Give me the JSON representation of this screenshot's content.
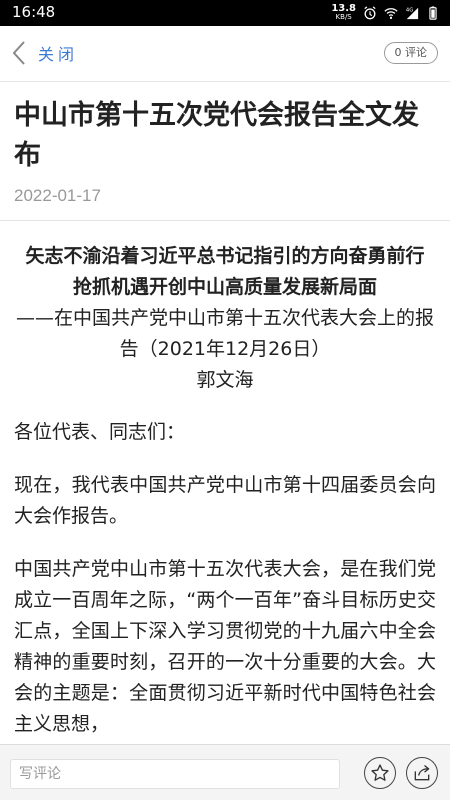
{
  "status_bar": {
    "time": "16:48",
    "net_speed_value": "13.8",
    "net_speed_unit": "KB/S",
    "network_type": "4G",
    "icons": [
      "alarm-icon",
      "wifi-icon",
      "signal-icon",
      "battery-icon"
    ]
  },
  "nav": {
    "back_label": "关闭",
    "comment_count": "0 评论"
  },
  "article": {
    "title": "中山市第十五次党代会报告全文发布",
    "date": "2022-01-17",
    "speech_title": "矢志不渝沿着习近平总书记指引的方向奋勇前行 抢抓机遇开创中山高质量发展新局面",
    "speech_subtitle": "——在中国共产党中山市第十五次代表大会上的报告（2021年12月26日）",
    "speech_author": "郭文海",
    "paragraphs": [
      "各位代表、同志们：",
      "现在，我代表中国共产党中山市第十四届委员会向大会作报告。",
      "中国共产党中山市第十五次代表大会，是在我们党成立一百周年之际，“两个一百年”奋斗目标历史交汇点，全国上下深入学习贯彻党的十九届六中全会精神的重要时刻，召开的一次十分重要的大会。大会的主题是：全面贯彻习近平新时代中国特色社会主义思想，"
    ]
  },
  "bottom_bar": {
    "comment_placeholder": "写评论",
    "favorite_icon": "star-icon",
    "share_icon": "share-icon"
  },
  "colors": {
    "accent": "#3a7bd5",
    "date": "#999999",
    "status_bar": "#000000"
  }
}
